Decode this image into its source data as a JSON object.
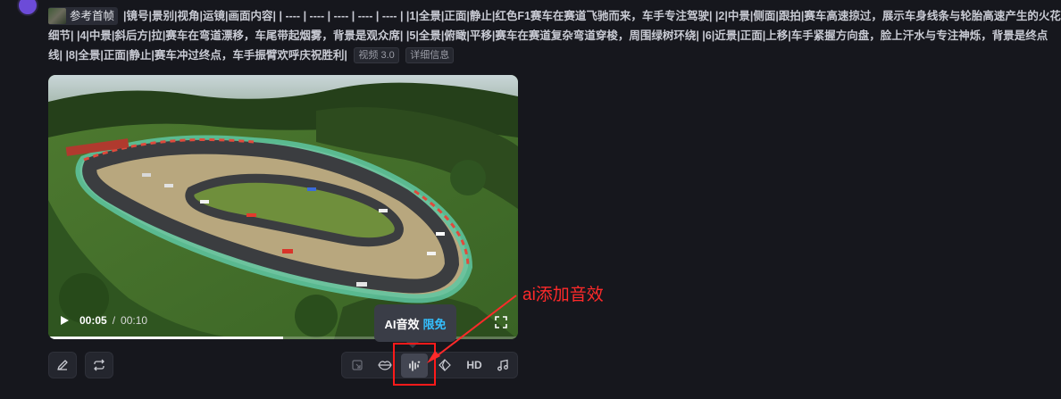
{
  "prompt": {
    "ref_label": "参考首帧",
    "text": "|镜号|景别|视角|运镜|画面内容| | ---- | ---- | ---- | ---- | ---- | |1|全景|正面|静止|红色F1赛车在赛道飞驰而来，车手专注驾驶| |2|中景|侧面|跟拍|赛车高速掠过，展示车身线条与轮胎高速产生的火花细节| |4|中景|斜后方|拉|赛车在弯道漂移，车尾带起烟雾，背景是观众席| |5|全景|俯瞰|平移|赛车在赛道复杂弯道穿梭，周围绿树环绕| |6|近景|正面|上移|车手紧握方向盘，脸上汗水与专注神烁，背景是终点线| |8|全景|正面|静止|赛车冲过终点，车手振臂欢呼庆祝胜利|",
    "tag_model": "视频 3.0",
    "tag_details": "详细信息"
  },
  "video": {
    "current_time": "00:05",
    "separator": "/",
    "total_time": "00:10",
    "progress": 0.5
  },
  "tooltip": {
    "label": "AI音效",
    "badge": "限免"
  },
  "toolbar": {
    "hd_label": "HD"
  },
  "annotation": {
    "text": "ai添加音效"
  },
  "icons": {
    "edit": "pencil-icon",
    "regenerate": "repeat-icon",
    "crop": "crop-icon",
    "lip_sync": "lips-icon",
    "ai_sound": "sound-wave-icon",
    "diamond": "diamond-icon",
    "music": "music-note-icon",
    "fullscreen": "fullscreen-icon",
    "play": "play-icon"
  },
  "colors": {
    "background": "#16171d",
    "accent_free": "#34c0ff",
    "annotation_red": "#ff2a2a"
  }
}
